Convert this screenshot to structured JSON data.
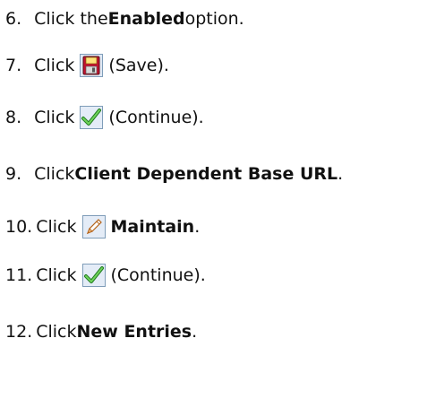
{
  "steps": [
    {
      "num": "6.",
      "pre": "Click the ",
      "bold": "Enabled",
      "post": " option."
    },
    {
      "num": "7.",
      "pre": "Click",
      "icon": "save-icon",
      "post": "(Save)."
    },
    {
      "num": "8.",
      "pre": "Click",
      "icon": "continue-checkmark-icon",
      "post": "(Continue)."
    },
    {
      "num": "9.",
      "pre": "Click ",
      "bold": "Client Dependent Base URL",
      "post": "."
    },
    {
      "num": "10.",
      "pre": "Click",
      "icon": "maintain-pencil-icon",
      "bold": "Maintain",
      "post": "."
    },
    {
      "num": "11.",
      "pre": "Click",
      "icon": "continue-checkmark-icon",
      "post": "(Continue)."
    },
    {
      "num": "12.",
      "pre": "Click ",
      "bold": "New Entries",
      "post": "."
    }
  ]
}
